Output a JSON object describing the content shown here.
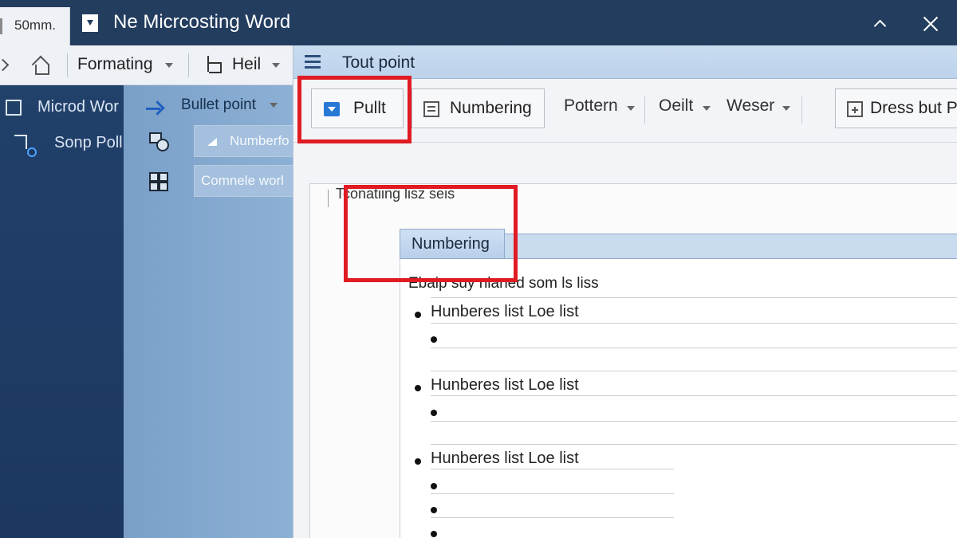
{
  "titlebar": {
    "tab_label": "50mm.",
    "app_title": "Ne Micrcosting Word"
  },
  "toolbar": {
    "formatting_label": "Formating",
    "heil_label": "Heil"
  },
  "leftnav": {
    "items": [
      {
        "label": "Microd Wor",
        "icon": "checkbox-icon"
      },
      {
        "label": "Sonp Poll",
        "icon": "connector-icon"
      }
    ]
  },
  "subpanel": {
    "bullet_point_label": "Bullet point",
    "numbering_field": "Numberfo",
    "complete_field": "Comnele worl"
  },
  "dialog": {
    "title": "Tout point",
    "ribbon": {
      "bullet_button": "Pullt",
      "numbering_button": "Numbering",
      "dropdowns": [
        "Pottern",
        "Oeilt",
        "Weser"
      ],
      "dress_button": "Dress but Pr"
    },
    "caption": "Tconatiing lisz seis",
    "inner_tab": "Numbering",
    "list_heading": "Ebaip suy nlaned som ls liss",
    "list_items": [
      "Hunberes list Loe list",
      "Hunberes list Loe list",
      "Hunberes list Loe list"
    ]
  },
  "colors": {
    "titlebar": "#233d5f",
    "highlight": "#e01b24",
    "accent": "#2878d6"
  }
}
